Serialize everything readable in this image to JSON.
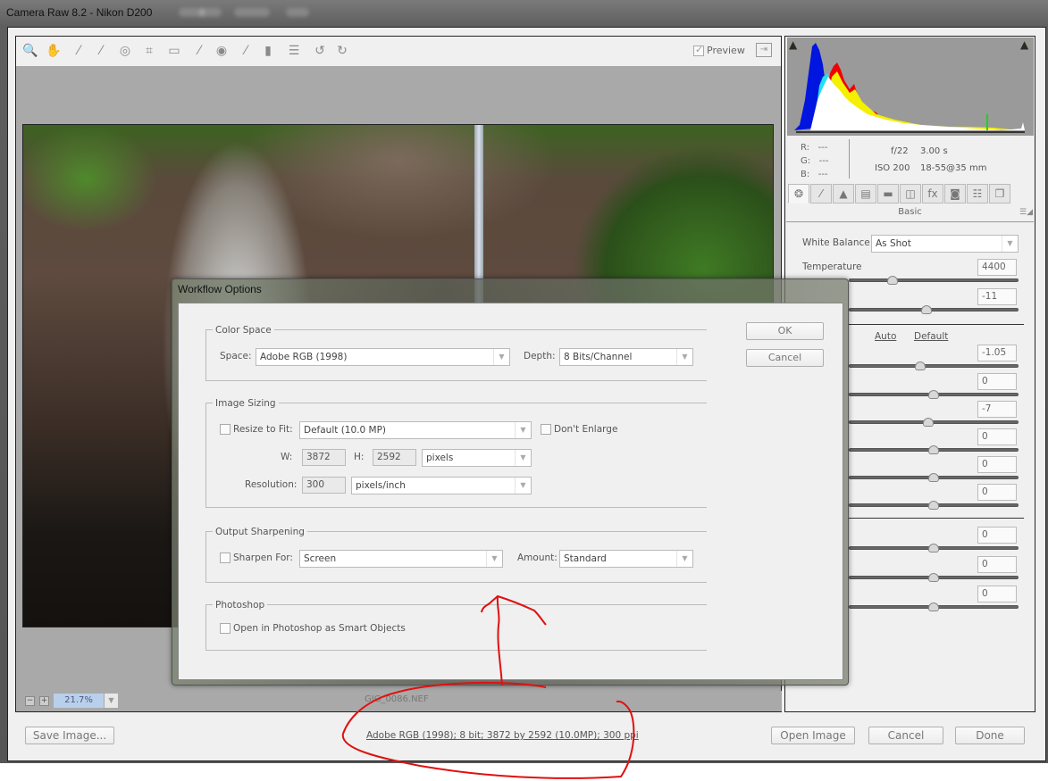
{
  "window": {
    "title": "Camera Raw 8.2  -  Nikon D200"
  },
  "toolbar": {
    "tools": [
      {
        "name": "zoom-tool",
        "glyph": "🔍"
      },
      {
        "name": "hand-tool",
        "glyph": "✋"
      },
      {
        "name": "white-balance-tool",
        "glyph": "⁄"
      },
      {
        "name": "color-sampler-tool",
        "glyph": "⁄"
      },
      {
        "name": "targeted-adjustment-tool",
        "glyph": "◎"
      },
      {
        "name": "crop-tool",
        "glyph": "⌗"
      },
      {
        "name": "straighten-tool",
        "glyph": "▭"
      },
      {
        "name": "spot-removal-tool",
        "glyph": "⁄"
      },
      {
        "name": "red-eye-removal-tool",
        "glyph": "◉"
      },
      {
        "name": "adjustment-brush-tool",
        "glyph": "⁄"
      },
      {
        "name": "graduated-filter-tool",
        "glyph": "▮"
      },
      {
        "name": "preferences-tool",
        "glyph": "☰"
      },
      {
        "name": "rotate-ccw-tool",
        "glyph": "↺"
      },
      {
        "name": "rotate-cw-tool",
        "glyph": "↻"
      }
    ],
    "preview_label": "Preview",
    "preview_checked": true
  },
  "canvas": {
    "zoom_minus": "−",
    "zoom_plus": "+",
    "zoom_level": "21.7%",
    "filename": "GJG_0086.NEF"
  },
  "histogram": {
    "r_label": "R:",
    "r_value": "---",
    "g_label": "G:",
    "g_value": "---",
    "b_label": "B:",
    "b_value": "---",
    "aperture": "f/22",
    "shutter": "3.00 s",
    "iso": "ISO 200",
    "lens": "18-55@35 mm"
  },
  "panel_tabs": [
    {
      "name": "basic",
      "glyph": "❂"
    },
    {
      "name": "tone-curve",
      "glyph": "⁄"
    },
    {
      "name": "detail",
      "glyph": "▲"
    },
    {
      "name": "hsl-grayscale",
      "glyph": "▤"
    },
    {
      "name": "split-toning",
      "glyph": "▬"
    },
    {
      "name": "lens-corrections",
      "glyph": "◫"
    },
    {
      "name": "effects",
      "glyph": "fx"
    },
    {
      "name": "camera-calibration",
      "glyph": "◙"
    },
    {
      "name": "presets",
      "glyph": "☷"
    },
    {
      "name": "snapshots",
      "glyph": "❐"
    }
  ],
  "basic_panel": {
    "title": "Basic",
    "white_balance_label": "White Balance:",
    "white_balance_value": "As Shot",
    "temperature_label": "Temperature",
    "auto_label": "Auto",
    "default_label": "Default",
    "sliders": [
      {
        "name": "temperature",
        "value": "4400",
        "position": 0.26
      },
      {
        "name": "tint",
        "value": "-11",
        "position": 0.46
      },
      {
        "name": "exposure",
        "value": "-1.05",
        "position": 0.42
      },
      {
        "name": "contrast",
        "value": "0",
        "position": 0.5
      },
      {
        "name": "highlights",
        "value": "-7",
        "position": 0.47
      },
      {
        "name": "shadows",
        "value": "0",
        "position": 0.5
      },
      {
        "name": "whites",
        "value": "0",
        "position": 0.5
      },
      {
        "name": "blacks",
        "value": "0",
        "position": 0.5
      },
      {
        "name": "clarity",
        "value": "0",
        "position": 0.5
      },
      {
        "name": "vibrance",
        "value": "0",
        "position": 0.5
      },
      {
        "name": "saturation",
        "value": "0",
        "position": 0.5
      }
    ]
  },
  "dialog": {
    "title": "Workflow Options",
    "ok_label": "OK",
    "cancel_label": "Cancel",
    "color_space": {
      "group_label": "Color Space",
      "space_label": "Space:",
      "space_value": "Adobe RGB (1998)",
      "depth_label": "Depth:",
      "depth_value": "8 Bits/Channel"
    },
    "image_sizing": {
      "group_label": "Image Sizing",
      "resize_label": "Resize to Fit:",
      "resize_checked": false,
      "resize_value": "Default  (10.0 MP)",
      "dont_enlarge_label": "Don't Enlarge",
      "dont_enlarge_checked": false,
      "w_label": "W:",
      "w_value": "3872",
      "h_label": "H:",
      "h_value": "2592",
      "units_value": "pixels",
      "resolution_label": "Resolution:",
      "resolution_value": "300",
      "resolution_units": "pixels/inch"
    },
    "output_sharpening": {
      "group_label": "Output Sharpening",
      "sharpen_label": "Sharpen For:",
      "sharpen_checked": false,
      "sharpen_value": "Screen",
      "amount_label": "Amount:",
      "amount_value": "Standard"
    },
    "photoshop": {
      "group_label": "Photoshop",
      "smart_objects_label": "Open in Photoshop as Smart Objects",
      "smart_objects_checked": false
    }
  },
  "footer": {
    "save_label": "Save Image...",
    "workflow_link": "Adobe RGB (1998); 8 bit; 3872 by 2592 (10.0MP); 300 ppi",
    "open_label": "Open Image",
    "cancel_label": "Cancel",
    "done_label": "Done"
  },
  "annotation": {
    "color": "#e01010"
  }
}
